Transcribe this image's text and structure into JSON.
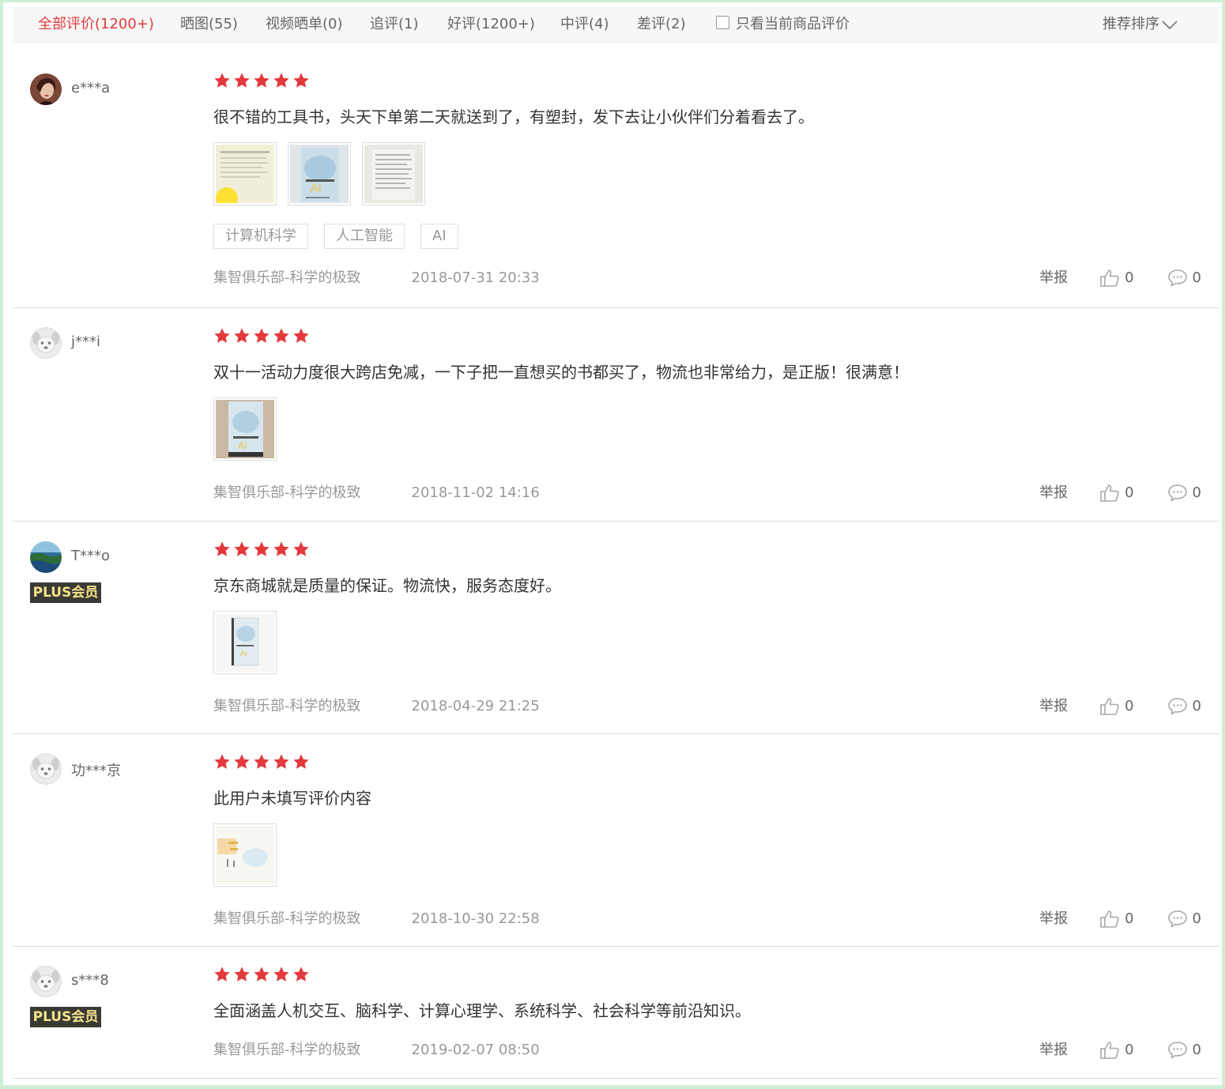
{
  "filter_tabs": [
    {
      "label": "全部评价(1200+)",
      "active": true
    },
    {
      "label": "晒图(55)",
      "active": false
    },
    {
      "label": "视频晒单(0)",
      "active": false
    },
    {
      "label": "追评(1)",
      "active": false
    },
    {
      "label": "好评(1200+)",
      "active": false
    },
    {
      "label": "中评(4)",
      "active": false
    },
    {
      "label": "差评(2)",
      "active": false
    }
  ],
  "only_current_label": "只看当前商品评价",
  "sort_label": "推荐排序",
  "actions": {
    "report_label": "举报"
  },
  "colors": {
    "accent": "#e4393c",
    "star": "#e4393c",
    "plus_badge_bg": "#3a3a35",
    "plus_badge_text": "#f5e28a"
  },
  "reviews": [
    {
      "username": "e***a",
      "avatar": "photo-avatar-woman",
      "plus_label": "",
      "rating": 5,
      "text": "很不错的工具书，头天下单第二天就送到了，有塑封，发下去让小伙伴们分着看去了。",
      "images": [
        "book-page-photo",
        "book-cover-photo",
        "book-text-page-photo"
      ],
      "tags": [
        "计算机科学",
        "人工智能",
        "AI"
      ],
      "store": "集智俱乐部-科学的极致",
      "date": "2018-07-31 20:33",
      "likes": "0",
      "replies": "0"
    },
    {
      "username": "j***i",
      "avatar": "default-dog-avatar",
      "plus_label": "",
      "rating": 5,
      "text": "双十一活动力度很大跨店免减，一下子把一直想买的书都买了，物流也非常给力，是正版！很满意！",
      "images": [
        "book-cover-photo"
      ],
      "tags": [],
      "store": "集智俱乐部-科学的极致",
      "date": "2018-11-02 14:16",
      "likes": "0",
      "replies": "0"
    },
    {
      "username": "T***o",
      "avatar": "landscape-avatar",
      "plus_label": "PLUS会员",
      "rating": 5,
      "text": "京东商城就是质量的保证。物流快，服务态度好。",
      "images": [
        "book-cover-photo"
      ],
      "tags": [],
      "store": "集智俱乐部-科学的极致",
      "date": "2018-04-29 21:25",
      "likes": "0",
      "replies": "0"
    },
    {
      "username": "功***京",
      "avatar": "default-dog-avatar",
      "plus_label": "",
      "rating": 5,
      "text": "此用户未填写评价内容",
      "images": [
        "book-inner-page-photo"
      ],
      "tags": [],
      "store": "集智俱乐部-科学的极致",
      "date": "2018-10-30 22:58",
      "likes": "0",
      "replies": "0"
    },
    {
      "username": "s***8",
      "avatar": "default-dog-avatar",
      "plus_label": "PLUS会员",
      "rating": 5,
      "text": "全面涵盖人机交互、脑科学、计算心理学、系统科学、社会科学等前沿知识。",
      "images": [],
      "tags": [],
      "store": "集智俱乐部-科学的极致",
      "date": "2019-02-07 08:50",
      "likes": "0",
      "replies": "0"
    }
  ]
}
